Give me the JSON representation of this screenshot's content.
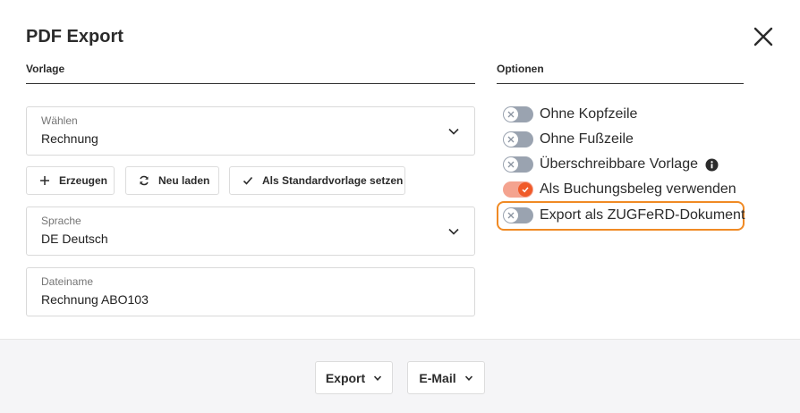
{
  "dialog": {
    "title": "PDF Export"
  },
  "left": {
    "section_title": "Vorlage",
    "template_select": {
      "label": "Wählen",
      "value": "Rechnung"
    },
    "buttons": {
      "generate": "Erzeugen",
      "reload": "Neu laden",
      "set_default": "Als Standardvorlage setzen"
    },
    "language_select": {
      "label": "Sprache",
      "value": "DE Deutsch"
    },
    "filename": {
      "label": "Dateiname",
      "value": "Rechnung ABO103"
    }
  },
  "right": {
    "section_title": "Optionen",
    "options": [
      {
        "label": "Ohne Kopfzeile",
        "checked": false
      },
      {
        "label": "Ohne Fußzeile",
        "checked": false
      },
      {
        "label": "Überschreibbare Vorlage",
        "checked": false,
        "info_icon": "info-icon"
      },
      {
        "label": "Als Buchungsbeleg verwenden",
        "checked": true
      },
      {
        "label": "Export als ZUGFeRD-Dokument",
        "checked": false,
        "highlighted": true
      }
    ]
  },
  "footer": {
    "export_label": "Export",
    "email_label": "E-Mail"
  },
  "colors": {
    "accent": "#f05a28",
    "toggle_off": "#9aa3b0",
    "highlight": "#f08a24"
  }
}
